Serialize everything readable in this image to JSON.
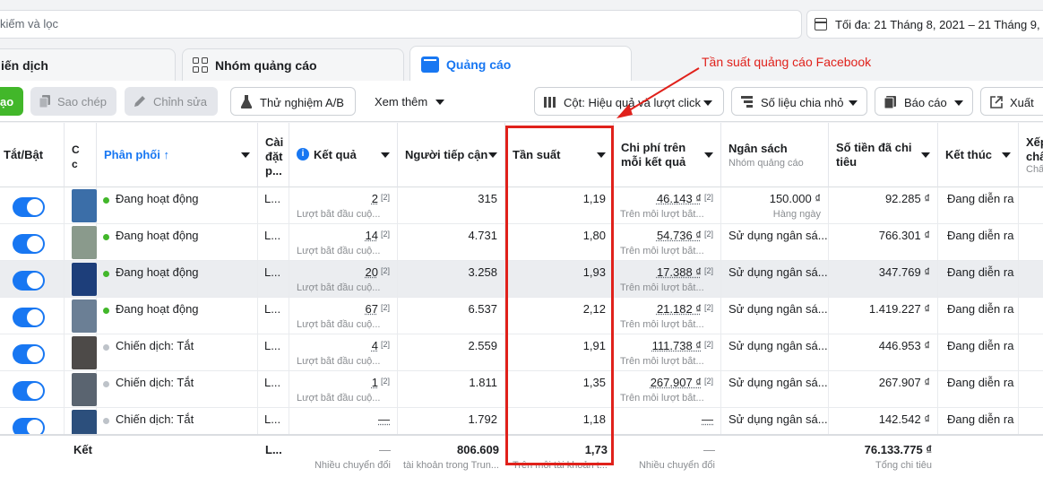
{
  "search": {
    "placeholder": "kiếm và lọc"
  },
  "date_range": "Tối đa: 21 Tháng 8, 2021 – 21 Tháng 9, 20",
  "tabs": [
    {
      "label": "iến dịch"
    },
    {
      "label": "Nhóm quảng cáo"
    },
    {
      "label": "Quảng cáo"
    }
  ],
  "toolbar": {
    "create_label": "ạo",
    "copy_label": "Sao chép",
    "edit_label": "Chỉnh sửa",
    "ab_label": "Thử nghiệm A/B",
    "more_label": "Xem thêm",
    "columns_label": "Cột: Hiệu quả và lượt click",
    "breakdown_label": "Số liệu chia nhỏ",
    "report_label": "Báo cáo",
    "export_label": "Xuất"
  },
  "headers": {
    "toggle": "Tắt/Bật",
    "c": "C",
    "c2": "c",
    "delivery": "Phân phối ↑",
    "settings": "Cài đặt p...",
    "results": "Kết quả",
    "reach": "Người tiếp cận",
    "frequency": "Tần suất",
    "cpr_line1": "Chi phí trên",
    "cpr_line2": "mỗi kết quả",
    "budget": "Ngân sách",
    "budget_sub": "Nhóm quảng cáo",
    "spent_line1": "Số tiền đã chi",
    "spent_line2": "tiêu",
    "end": "Kết thúc",
    "rank_line1": "Xếp",
    "rank_line2": "chấ",
    "rank_sub": "Chấ"
  },
  "rows": [
    {
      "status": "Đang hoạt động",
      "status_color": "#42b72a",
      "settings": "L...",
      "result": "2",
      "result_sub": "Lượt bắt đầu cuộ...",
      "reach": "315",
      "frequency": "1,19",
      "cpr": "46.143 ₫",
      "cpr_sub": "Trên mỗi lượt bắt...",
      "budget": "150.000 ₫",
      "budget_sub": "Hàng ngày",
      "spent": "92.285 ₫",
      "end": "Đang diễn ra",
      "thumb": "#3b6ea8"
    },
    {
      "status": "Đang hoạt động",
      "status_color": "#42b72a",
      "settings": "L...",
      "result": "14",
      "result_sub": "Lượt bắt đầu cuộ...",
      "reach": "4.731",
      "frequency": "1,80",
      "cpr": "54.736 ₫",
      "cpr_sub": "Trên mỗi lượt bắt...",
      "budget": "Sử dụng ngân sá...",
      "budget_sub": "",
      "spent": "766.301 ₫",
      "end": "Đang diễn ra",
      "thumb": "#8a9a8c"
    },
    {
      "status": "Đang hoạt động",
      "status_color": "#42b72a",
      "settings": "L...",
      "result": "20",
      "result_sub": "Lượt bắt đầu cuộ...",
      "reach": "3.258",
      "frequency": "1,93",
      "cpr": "17.388 ₫",
      "cpr_sub": "Trên mỗi lượt bắt...",
      "budget": "Sử dụng ngân sá...",
      "budget_sub": "",
      "spent": "347.769 ₫",
      "end": "Đang diễn ra",
      "thumb": "#1d3e7a"
    },
    {
      "status": "Đang hoạt động",
      "status_color": "#42b72a",
      "settings": "L...",
      "result": "67",
      "result_sub": "Lượt bắt đầu cuộ...",
      "reach": "6.537",
      "frequency": "2,12",
      "cpr": "21.182 ₫",
      "cpr_sub": "Trên mỗi lượt bắt...",
      "budget": "Sử dụng ngân sá...",
      "budget_sub": "",
      "spent": "1.419.227 ₫",
      "end": "Đang diễn ra",
      "thumb": "#6b7f95"
    },
    {
      "status": "Chiến dịch: Tắt",
      "status_color": "#bec3c9",
      "settings": "L...",
      "result": "4",
      "result_sub": "Lượt bắt đầu cuộ...",
      "reach": "2.559",
      "frequency": "1,91",
      "cpr": "111.738 ₫",
      "cpr_sub": "Trên mỗi lượt bắt...",
      "budget": "Sử dụng ngân sá...",
      "budget_sub": "",
      "spent": "446.953 ₫",
      "end": "Đang diễn ra",
      "thumb": "#4d4a48"
    },
    {
      "status": "Chiến dịch: Tắt",
      "status_color": "#bec3c9",
      "settings": "L...",
      "result": "1",
      "result_sub": "Lượt bắt đầu cuộ...",
      "reach": "1.811",
      "frequency": "1,35",
      "cpr": "267.907 ₫",
      "cpr_sub": "Trên mỗi lượt bắt...",
      "budget": "Sử dụng ngân sá...",
      "budget_sub": "",
      "spent": "267.907 ₫",
      "end": "Đang diễn ra",
      "thumb": "#5a6470"
    },
    {
      "status": "Chiến dịch: Tắt",
      "status_color": "#bec3c9",
      "settings": "L...",
      "result": "—",
      "result_sub": "",
      "reach": "1.792",
      "frequency": "1,18",
      "cpr": "—",
      "cpr_sub": "",
      "budget": "Sử dụng ngân sá...",
      "budget_sub": "",
      "spent": "142.542 ₫",
      "end": "Đang diễn ra",
      "thumb": "#2c4f7c"
    }
  ],
  "footer": {
    "label": "Kết",
    "settings": "L...",
    "result": "—",
    "result_sub": "Nhiều chuyển đổi",
    "reach": "806.609",
    "reach_sub": "tài khoản trong Trun...",
    "frequency": "1,73",
    "frequency_sub": "Trên mỗi tài khoản t...",
    "cpr": "—",
    "cpr_sub": "Nhiều chuyển đổi",
    "spent": "76.133.775 ₫",
    "spent_sub": "Tổng chi tiêu"
  },
  "annotation": "Tần suất quảng cáo Facebook",
  "colors": {
    "accent": "#1877f2",
    "annotation": "#e0211b",
    "active": "#42b72a"
  }
}
